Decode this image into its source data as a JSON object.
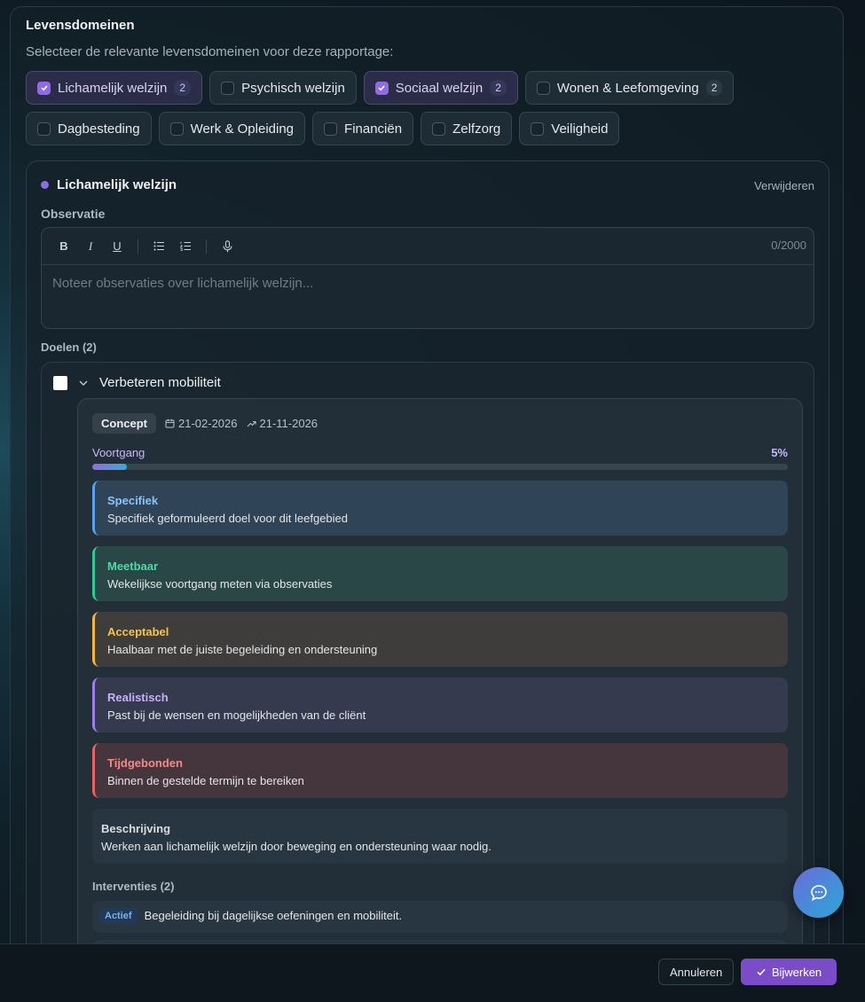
{
  "panel": {
    "title": "Levensdomeinen",
    "subtitle": "Selecteer de relevante levensdomeinen voor deze rapportage:"
  },
  "domains": [
    {
      "label": "Lichamelijk welzijn",
      "selected": true,
      "count": "2"
    },
    {
      "label": "Psychisch welzijn",
      "selected": false
    },
    {
      "label": "Sociaal welzijn",
      "selected": true,
      "count": "2"
    },
    {
      "label": "Wonen & Leefomgeving",
      "selected": false,
      "count": "2"
    },
    {
      "label": "Dagbesteding",
      "selected": false
    },
    {
      "label": "Werk & Opleiding",
      "selected": false
    },
    {
      "label": "Financiën",
      "selected": false
    },
    {
      "label": "Zelfzorg",
      "selected": false
    },
    {
      "label": "Veiligheid",
      "selected": false
    }
  ],
  "domain_card": {
    "title": "Lichamelijk welzijn",
    "remove_label": "Verwijderen",
    "observation_label": "Observatie",
    "editor": {
      "toolbar": [
        "B",
        "I",
        "U"
      ],
      "counter": "0/2000",
      "placeholder": "Noteer observaties over lichamelijk welzijn..."
    },
    "goals_label": "Doelen (2)",
    "goal": {
      "title": "Verbeteren mobiliteit",
      "status": "Concept",
      "start_date": "21-02-2026",
      "end_date": "21-11-2026",
      "progress_label": "Voortgang",
      "progress_text": "5%",
      "progress": 0.05,
      "smart": [
        {
          "title": "Specifiek",
          "text": "Specifiek geformuleerd doel voor dit leefgebied"
        },
        {
          "title": "Meetbaar",
          "text": "Wekelijkse voortgang meten via observaties"
        },
        {
          "title": "Acceptabel",
          "text": "Haalbaar met de juiste begeleiding en ondersteuning"
        },
        {
          "title": "Realistisch",
          "text": "Past bij de wensen en mogelijkheden van de cliënt"
        },
        {
          "title": "Tijdgebonden",
          "text": "Binnen de gestelde termijn te bereiken"
        }
      ],
      "description": {
        "title": "Beschrijving",
        "text": "Werken aan lichamelijk welzijn door beweging en ondersteuning waar nodig."
      },
      "interventions_label": "Interventies (2)",
      "interventions": [
        {
          "status": "Actief",
          "text": "Begeleiding bij dagelijkse oefeningen en mobiliteit."
        }
      ]
    }
  },
  "footer": {
    "cancel_label": "Annuleren",
    "update_label": "Bijwerken"
  },
  "colors": {
    "accent": "#7b4cc8",
    "selected_check": "#8f6ce0"
  }
}
